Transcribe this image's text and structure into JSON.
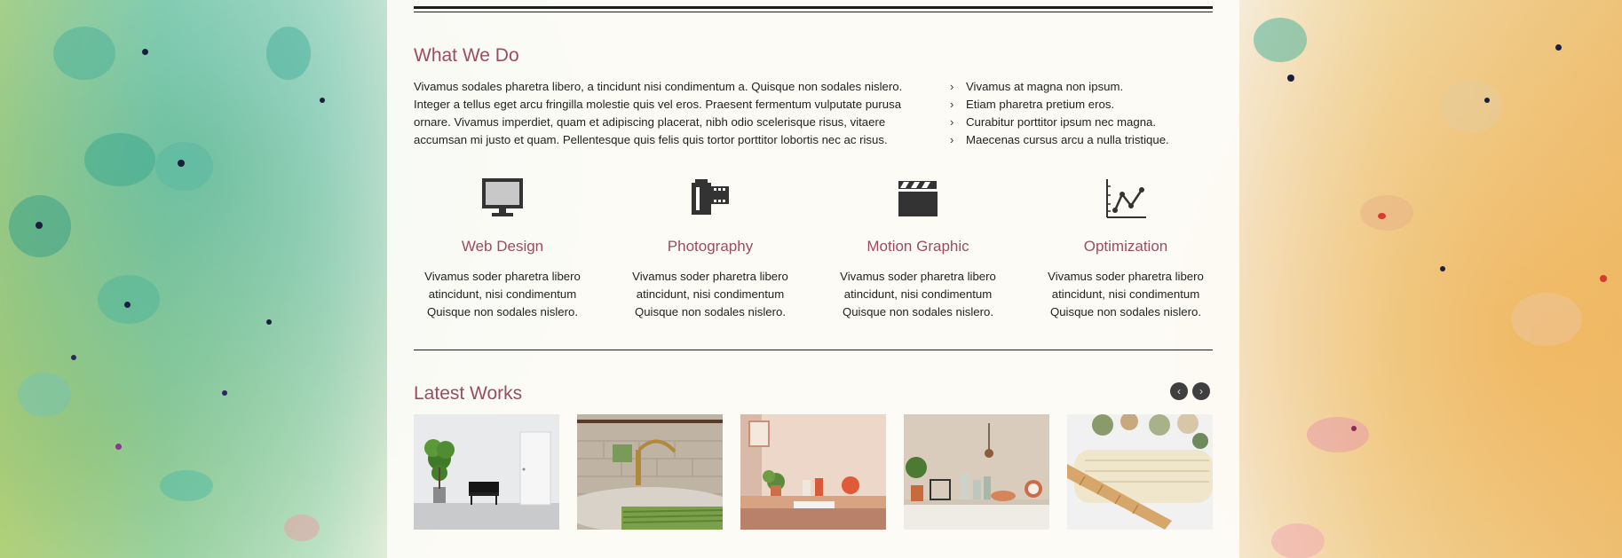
{
  "what_we_do": {
    "title": "What We Do",
    "intro": "Vivamus sodales pharetra libero, a tincidunt nisi condimentum a. Quisque non sodales nislero. Integer a tellus eget arcu fringilla molestie quis vel eros. Praesent fermentum vulputate purusa ornare. Vivamus imperdiet, quam et adipiscing placerat, nibh odio scelerisque risus, vitaere accumsan mi justo et quam. Pellentesque quis felis quis tortor porttitor lobortis nec ac risus.",
    "bullets": [
      "Vivamus at magna non ipsum.",
      "Etiam pharetra pretium eros.",
      "Curabitur porttitor ipsum nec magna.",
      "Maecenas cursus arcu a nulla tristique."
    ]
  },
  "services": [
    {
      "icon": "monitor-icon",
      "title": "Web Design",
      "text": "Vivamus soder pharetra libero atincidunt, nisi condimentum Quisque non sodales nislero."
    },
    {
      "icon": "film-roll-icon",
      "title": "Photography",
      "text": "Vivamus soder pharetra libero atincidunt, nisi condimentum Quisque non sodales nislero."
    },
    {
      "icon": "clapperboard-icon",
      "title": "Motion Graphic",
      "text": "Vivamus soder pharetra libero atincidunt, nisi condimentum Quisque non sodales nislero."
    },
    {
      "icon": "line-chart-icon",
      "title": "Optimization",
      "text": "Vivamus soder pharetra libero atincidunt, nisi condimentum Quisque non sodales nislero."
    }
  ],
  "latest_works": {
    "title": "Latest Works",
    "prev_icon": "chevron-left-icon",
    "next_icon": "chevron-right-icon",
    "items": [
      {
        "image": "white-room-with-plant-and-chair-photo"
      },
      {
        "image": "kitchen-sink-with-asparagus-photo"
      },
      {
        "image": "pink-shelf-with-plant-photo"
      },
      {
        "image": "shelf-with-plants-and-bottles-photo"
      },
      {
        "image": "towel-with-flowers-and-comb-photo"
      }
    ]
  },
  "colors": {
    "heading": "#9b4d5e",
    "text": "#222222",
    "rule": "#1d1d1d",
    "icon": "#333333",
    "nav_button": "#3f3f3f"
  }
}
